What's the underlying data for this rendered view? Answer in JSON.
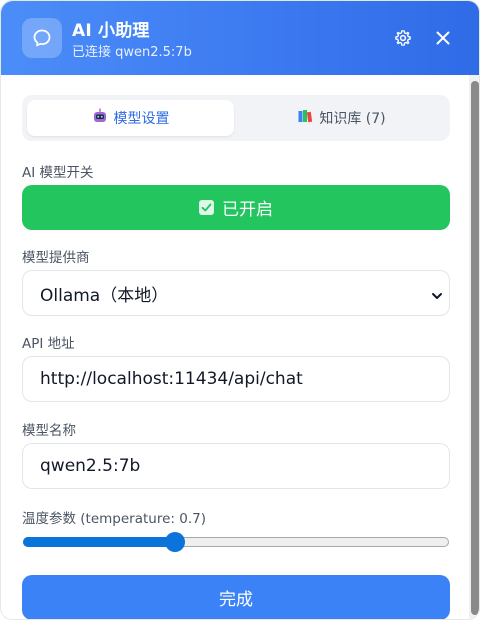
{
  "header": {
    "title": "AI 小助理",
    "status": "已连接 qwen2.5:7b",
    "logo_icon": "chat-bubble-icon",
    "settings_icon": "gear-icon",
    "close_icon": "close-icon"
  },
  "tabs": [
    {
      "label": "模型设置",
      "icon": "robot-icon",
      "active": true
    },
    {
      "label": "知识库 (7)",
      "icon": "books-icon",
      "active": false
    }
  ],
  "form": {
    "toggle": {
      "label": "AI 模型开关",
      "button_text": "已开启",
      "checked": true
    },
    "provider": {
      "label": "模型提供商",
      "value": "Ollama（本地）"
    },
    "api": {
      "label": "API 地址",
      "value": "http://localhost:11434/api/chat"
    },
    "model": {
      "label": "模型名称",
      "value": "qwen2.5:7b"
    },
    "temperature": {
      "label": "温度参数 (temperature: 0.7)",
      "value": 0.7,
      "min": 0,
      "max": 2
    }
  },
  "done_button": "完成",
  "colors": {
    "header_gradient_start": "#4b8df8",
    "header_gradient_end": "#2f6be6",
    "toggle_on": "#22c55e",
    "primary": "#3b82f6",
    "slider": "#0a74da"
  }
}
